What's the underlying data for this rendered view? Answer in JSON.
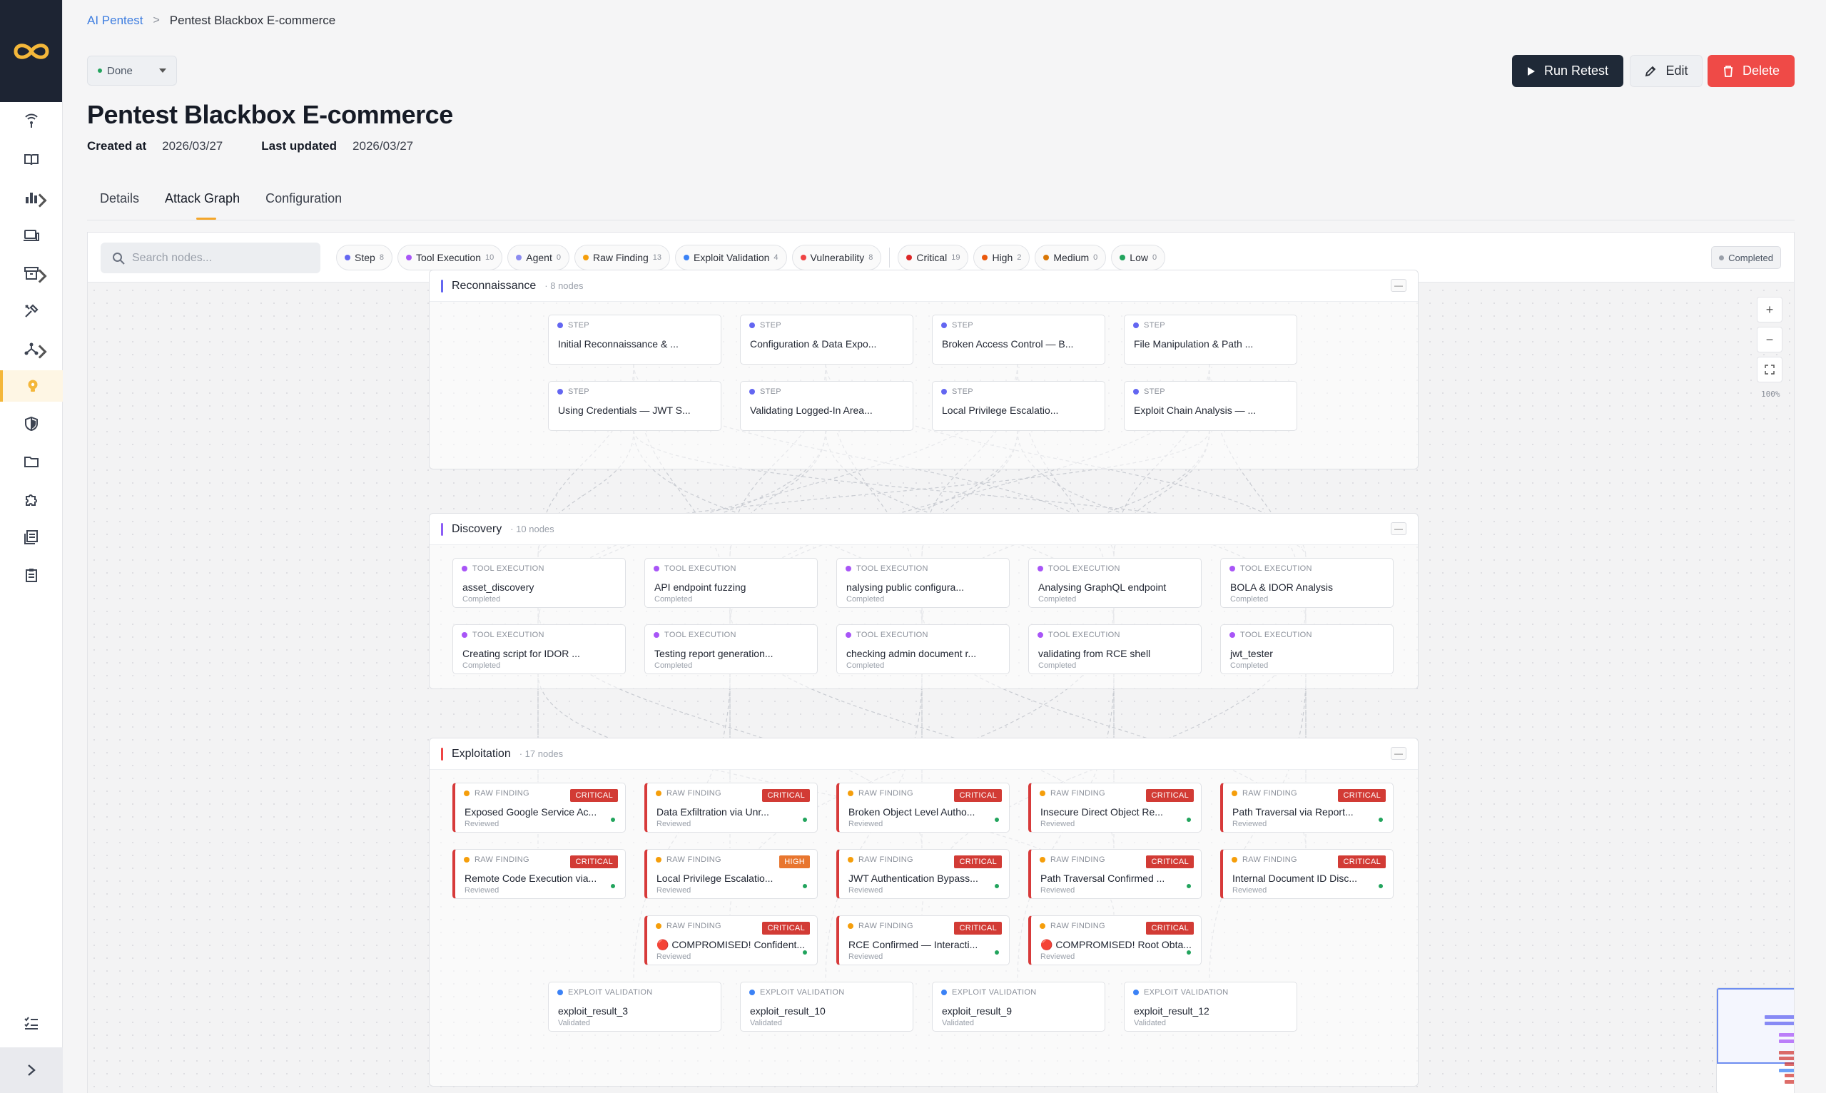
{
  "breadcrumb": {
    "root": "AI Pentest",
    "separator": ">",
    "current": "Pentest Blackbox E-commerce"
  },
  "status": {
    "label": "Done"
  },
  "title": "Pentest Blackbox E-commerce",
  "meta": {
    "created_label": "Created at",
    "created_value": "2026/03/27",
    "updated_label": "Last updated",
    "updated_value": "2026/03/27"
  },
  "actions": {
    "retest": "Run Retest",
    "edit": "Edit",
    "delete": "Delete"
  },
  "tabs": [
    "Details",
    "Attack Graph",
    "Configuration"
  ],
  "toolbar": {
    "search_placeholder": "Search nodes...",
    "type_filters": [
      {
        "label": "Step",
        "count": "8",
        "color": "#6366f1"
      },
      {
        "label": "Tool Execution",
        "count": "10",
        "color": "#a855f7"
      },
      {
        "label": "Agent",
        "count": "0",
        "color": "#8b8bf0"
      },
      {
        "label": "Raw Finding",
        "count": "13",
        "color": "#f59e0b"
      },
      {
        "label": "Exploit Validation",
        "count": "4",
        "color": "#3b82f6"
      },
      {
        "label": "Vulnerability",
        "count": "8",
        "color": "#ef4444"
      }
    ],
    "severity_filters": [
      {
        "label": "Critical",
        "count": "19",
        "color": "#dc2626"
      },
      {
        "label": "High",
        "count": "2",
        "color": "#ea580c"
      },
      {
        "label": "Medium",
        "count": "0",
        "color": "#d97706"
      },
      {
        "label": "Low",
        "count": "0",
        "color": "#22a45d"
      }
    ],
    "status_chip": "Completed"
  },
  "zoom": {
    "in": "+",
    "out": "−",
    "level": "100%"
  },
  "groups": [
    {
      "name": "Reconnaissance",
      "count": "8 nodes",
      "accent": "#6366f1",
      "nodes": [
        {
          "type": "STEP",
          "label": "Initial Reconnaissance & ...",
          "sub": ""
        },
        {
          "type": "STEP",
          "label": "Configuration & Data Expo...",
          "sub": ""
        },
        {
          "type": "STEP",
          "label": "Broken Access Control — B...",
          "sub": ""
        },
        {
          "type": "STEP",
          "label": "File Manipulation & Path ...",
          "sub": ""
        },
        {
          "type": "STEP",
          "label": "Using Credentials — JWT S...",
          "sub": ""
        },
        {
          "type": "STEP",
          "label": "Validating Logged-In Area...",
          "sub": ""
        },
        {
          "type": "STEP",
          "label": "Local Privilege Escalatio...",
          "sub": ""
        },
        {
          "type": "STEP",
          "label": "Exploit Chain Analysis — ...",
          "sub": ""
        }
      ]
    },
    {
      "name": "Discovery",
      "count": "10 nodes",
      "accent": "#8b5cf6",
      "nodes": [
        {
          "type": "TOOL EXECUTION",
          "label": "asset_discovery",
          "sub": "Completed"
        },
        {
          "type": "TOOL EXECUTION",
          "label": "API endpoint fuzzing",
          "sub": "Completed"
        },
        {
          "type": "TOOL EXECUTION",
          "label": "nalysing public configura...",
          "sub": "Completed"
        },
        {
          "type": "TOOL EXECUTION",
          "label": "Analysing GraphQL endpoint",
          "sub": "Completed"
        },
        {
          "type": "TOOL EXECUTION",
          "label": "BOLA & IDOR Analysis",
          "sub": "Completed"
        },
        {
          "type": "TOOL EXECUTION",
          "label": "Creating script for IDOR ...",
          "sub": "Completed"
        },
        {
          "type": "TOOL EXECUTION",
          "label": "Testing report generation...",
          "sub": "Completed"
        },
        {
          "type": "TOOL EXECUTION",
          "label": "checking admin document r...",
          "sub": "Completed"
        },
        {
          "type": "TOOL EXECUTION",
          "label": "validating from RCE shell",
          "sub": "Completed"
        },
        {
          "type": "TOOL EXECUTION",
          "label": "jwt_tester",
          "sub": "Completed"
        }
      ]
    },
    {
      "name": "Exploitation",
      "count": "17 nodes",
      "accent": "#ef4444",
      "findings": [
        {
          "type": "RAW FINDING",
          "label": "Exposed Google Service Ac...",
          "sub": "Reviewed",
          "severity": "CRITICAL"
        },
        {
          "type": "RAW FINDING",
          "label": "Data Exfiltration via Unr...",
          "sub": "Reviewed",
          "severity": "CRITICAL"
        },
        {
          "type": "RAW FINDING",
          "label": "Broken Object Level Autho...",
          "sub": "Reviewed",
          "severity": "CRITICAL"
        },
        {
          "type": "RAW FINDING",
          "label": "Insecure Direct Object Re...",
          "sub": "Reviewed",
          "severity": "CRITICAL"
        },
        {
          "type": "RAW FINDING",
          "label": "Path Traversal via Report...",
          "sub": "Reviewed",
          "severity": "CRITICAL"
        },
        {
          "type": "RAW FINDING",
          "label": "Remote Code Execution via...",
          "sub": "Reviewed",
          "severity": "CRITICAL"
        },
        {
          "type": "RAW FINDING",
          "label": "Local Privilege Escalatio...",
          "sub": "Reviewed",
          "severity": "HIGH"
        },
        {
          "type": "RAW FINDING",
          "label": "JWT Authentication Bypass...",
          "sub": "Reviewed",
          "severity": "CRITICAL"
        },
        {
          "type": "RAW FINDING",
          "label": "Path Traversal Confirmed ...",
          "sub": "Reviewed",
          "severity": "CRITICAL"
        },
        {
          "type": "RAW FINDING",
          "label": "Internal Document ID Disc...",
          "sub": "Reviewed",
          "severity": "CRITICAL"
        },
        {
          "type": "RAW FINDING",
          "label": "🔴 COMPROMISED! Confident...",
          "sub": "Reviewed",
          "severity": "CRITICAL"
        },
        {
          "type": "RAW FINDING",
          "label": "RCE Confirmed — Interacti...",
          "sub": "Reviewed",
          "severity": "CRITICAL"
        },
        {
          "type": "RAW FINDING",
          "label": "🔴 COMPROMISED! Root Obta...",
          "sub": "Reviewed",
          "severity": "CRITICAL"
        }
      ],
      "validations": [
        {
          "type": "EXPLOIT VALIDATION",
          "label": "exploit_result_3",
          "sub": "Validated"
        },
        {
          "type": "EXPLOIT VALIDATION",
          "label": "exploit_result_10",
          "sub": "Validated"
        },
        {
          "type": "EXPLOIT VALIDATION",
          "label": "exploit_result_9",
          "sub": "Validated"
        },
        {
          "type": "EXPLOIT VALIDATION",
          "label": "exploit_result_12",
          "sub": "Validated"
        }
      ]
    }
  ],
  "colors": {
    "step": "#6366f1",
    "tool": "#a855f7",
    "finding": "#f59e0b",
    "validation": "#3b82f6",
    "critical": "#d23b35",
    "high": "#e8762f",
    "accent": "#f4b73a"
  },
  "sidebar_icons": [
    "radar-icon",
    "book-icon",
    "chart-icon",
    "devices-icon",
    "archive-icon",
    "tools-icon",
    "network-icon",
    "bulb-icon",
    "shield-icon",
    "folder-icon",
    "puzzle-icon",
    "reports-icon",
    "clipboard-icon",
    "checklist-icon"
  ]
}
